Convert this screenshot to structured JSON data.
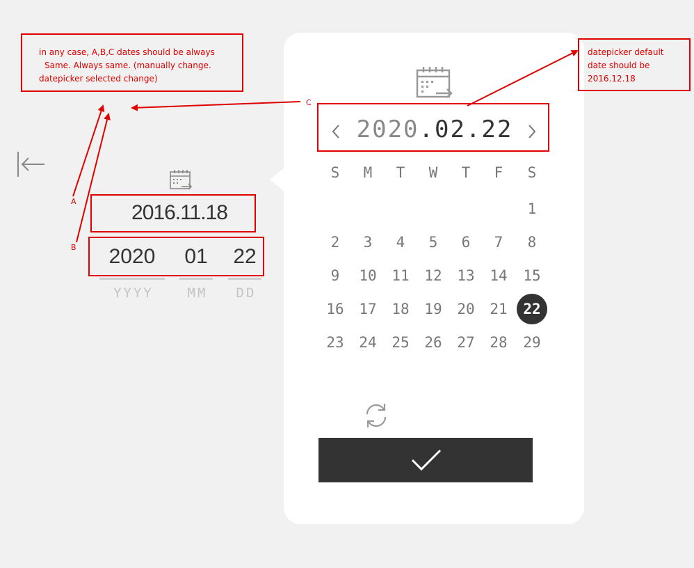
{
  "annotations": {
    "note_top_left": [
      "in any case, A,B,C dates should be always",
      "Same. Always same. (manually change.",
      "datepicker selected change)"
    ],
    "note_top_right": [
      "datepicker default",
      "date should be",
      "2016.12.18"
    ],
    "label_a": "A",
    "label_b": "B",
    "label_c": "C"
  },
  "left_panel": {
    "back_icon": "arrow-left-bar-icon",
    "calendar_icon": "calendar-icon",
    "date_a": "2016.11.18",
    "year_value": "2020",
    "month_value": "01",
    "day_value": "22",
    "year_label": "YYYY",
    "month_label": "MM",
    "day_label": "DD"
  },
  "datepicker": {
    "calendar_icon": "calendar-icon",
    "prev_icon": "chevron-left-icon",
    "next_icon": "chevron-right-icon",
    "header_year": "2020",
    "header_rest": ".02.22",
    "weekdays": [
      "S",
      "M",
      "T",
      "W",
      "T",
      "F",
      "S"
    ],
    "days": [
      "1",
      "2",
      "3",
      "4",
      "5",
      "6",
      "7",
      "8",
      "9",
      "10",
      "11",
      "12",
      "13",
      "14",
      "15",
      "16",
      "17",
      "18",
      "19",
      "20",
      "21",
      "22",
      "23",
      "24",
      "25",
      "26",
      "27",
      "28",
      "29"
    ],
    "first_weekday_index": 6,
    "selected_day": "22",
    "reset_icon": "refresh-icon",
    "confirm_icon": "check-icon"
  },
  "colors": {
    "annotation": "#e00000",
    "selected_bg": "#333333",
    "page_bg": "#f1f1f1"
  }
}
